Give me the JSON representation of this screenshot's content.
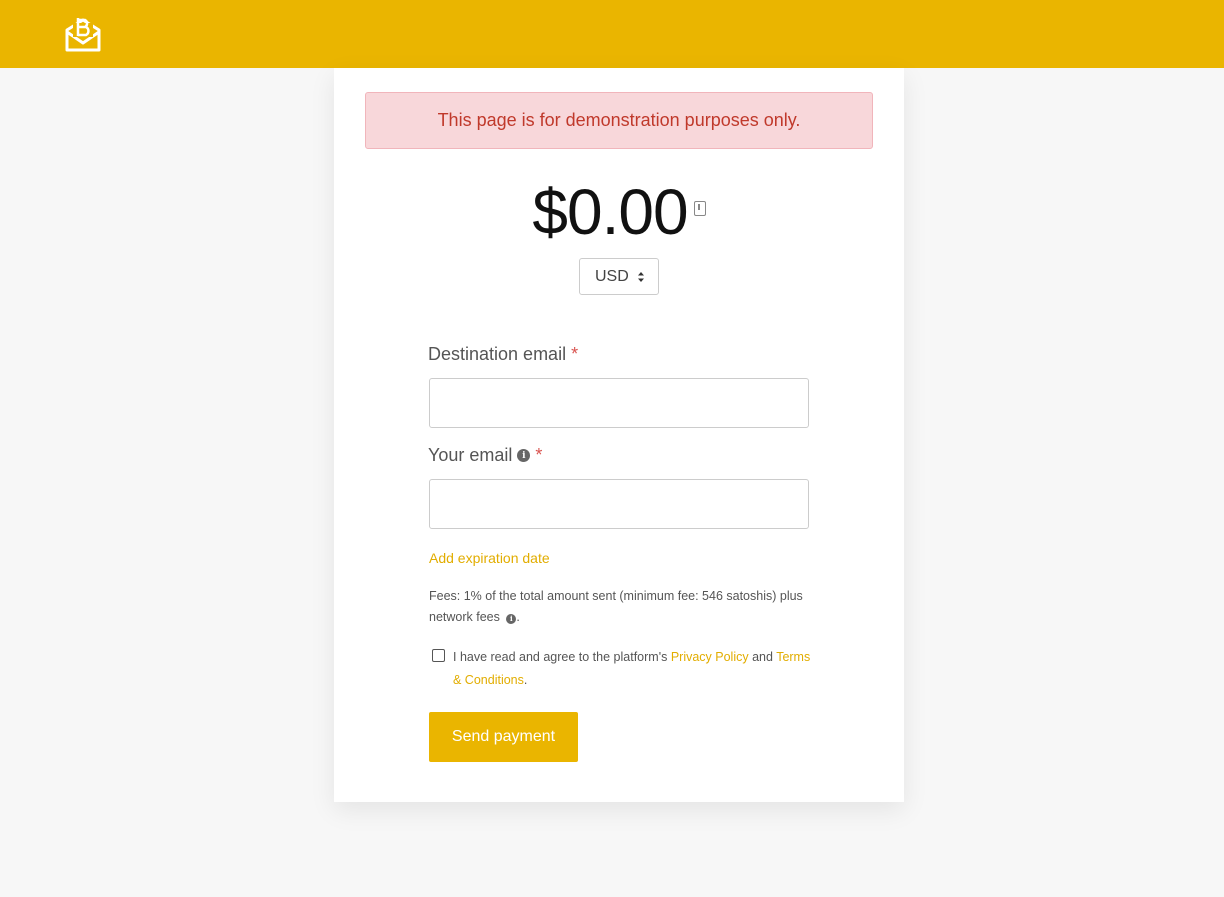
{
  "colors": {
    "brand": "#eab500",
    "alert_bg": "#f8d7da",
    "alert_text": "#c0392b",
    "required": "#d9534f"
  },
  "header": {
    "logo_icon": "envelope-bitcoin-logo-icon"
  },
  "alert": {
    "text": "This page is for demonstration purposes only."
  },
  "amount": {
    "value": "$0.00",
    "icon": "receipt-icon"
  },
  "currency": {
    "selected": "USD"
  },
  "form": {
    "destination_email": {
      "label": "Destination email",
      "required_mark": "*",
      "value": ""
    },
    "your_email": {
      "label": "Your email",
      "required_mark": "*",
      "info_icon": "i",
      "value": ""
    },
    "add_expiration": "Add expiration date",
    "fees_text": "Fees: 1% of the total amount sent (minimum fee: 546 satoshis) plus network fees",
    "fees_end": ".",
    "agree": {
      "prefix": "I have read and agree to the platform's ",
      "privacy_link": "Privacy Policy",
      "and": " and ",
      "terms_link": "Terms & Conditions",
      "suffix": "."
    },
    "submit_label": "Send payment"
  }
}
